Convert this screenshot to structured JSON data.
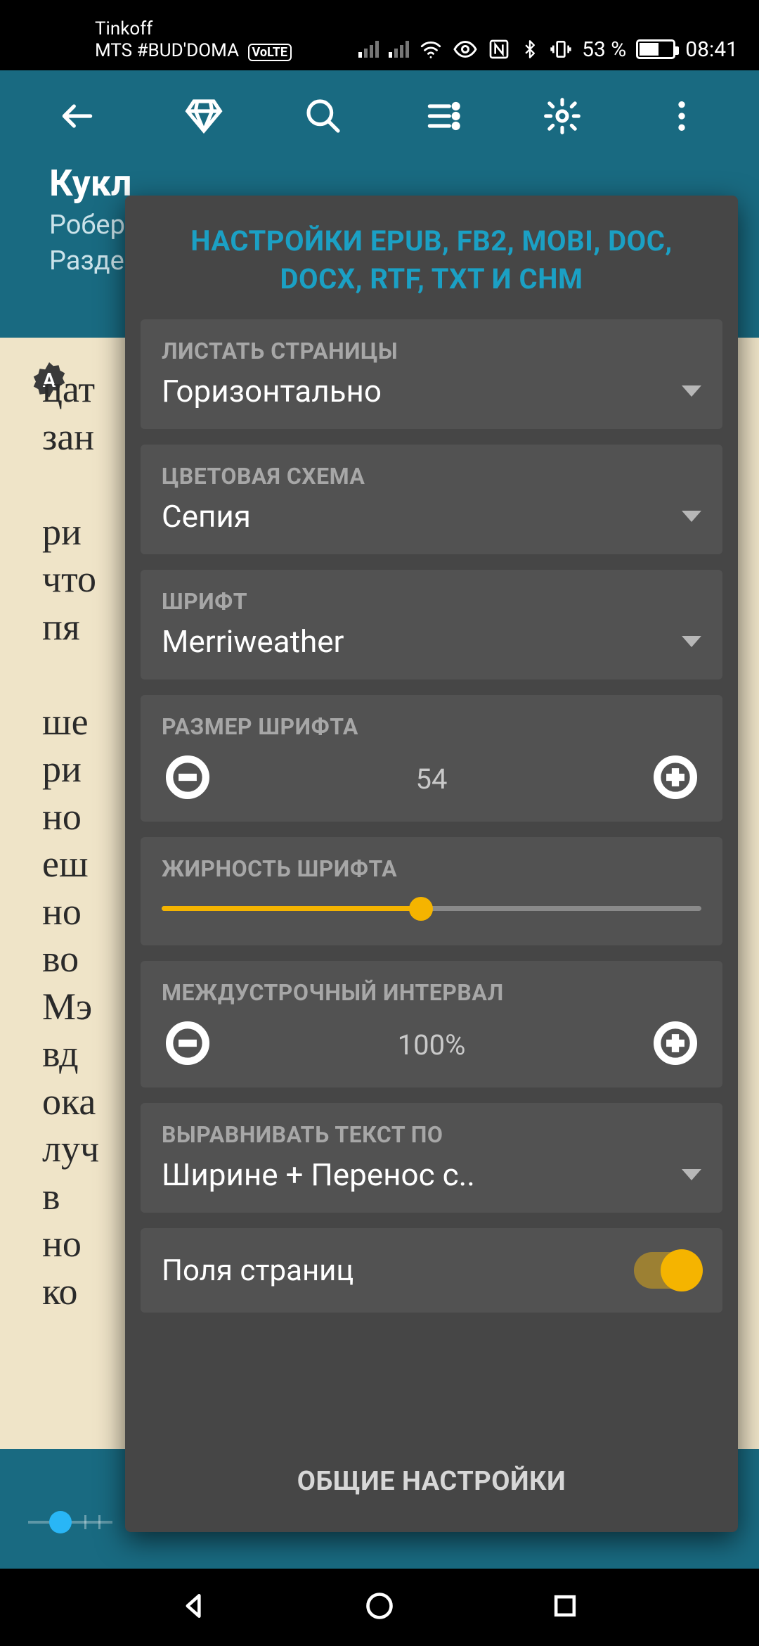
{
  "status": {
    "carrier1": "Tinkoff",
    "carrier2": "MTS #BUD'DOMA",
    "volte": "VoLTE",
    "battery_pct": "53 %",
    "time": "08:41"
  },
  "book": {
    "title_fragment": "Кукл",
    "author_fragment": "Робер",
    "chapter_fragment": "Разде"
  },
  "page_text": "цат\nзан\n \nри\nчто\nпя\n \nше\nри\nно\nеш\nно\nво\nМэ\nвд\nока\nлуч\nв \nно\nко",
  "dialog": {
    "title": "НАСТРОЙКИ EPUB, FB2, MOBI, DOC, DOCX, RTF, TXT И CHM",
    "paging": {
      "label": "ЛИСТАТЬ СТРАНИЦЫ",
      "value": "Горизонтально"
    },
    "color": {
      "label": "ЦВЕТОВАЯ СХЕМА",
      "value": "Сепия"
    },
    "font": {
      "label": "ШРИФТ",
      "value": "Merriweather"
    },
    "font_size": {
      "label": "РАЗМЕР ШРИФТА",
      "value": "54"
    },
    "font_weight": {
      "label": "ЖИРНОСТЬ ШРИФТА",
      "percent": 48
    },
    "line_spacing": {
      "label": "МЕЖДУСТРОЧНЫЙ ИНТЕРВАЛ",
      "value": "100%"
    },
    "align": {
      "label": "ВЫРАВНИВАТЬ ТЕКСТ ПО",
      "value": "Ширине + Перенос с.."
    },
    "margins": {
      "label": "Поля страниц",
      "enabled": true
    },
    "footer": "ОБЩИЕ НАСТРОЙКИ"
  }
}
